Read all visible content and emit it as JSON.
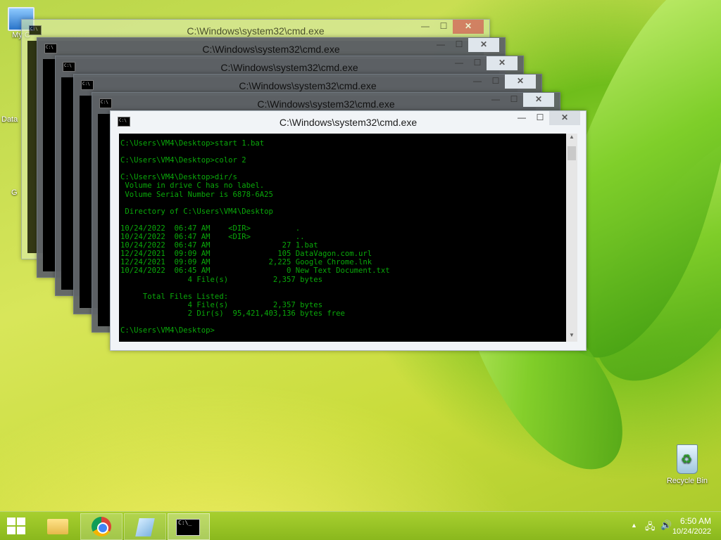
{
  "desktop": {
    "icons": [
      {
        "label": "My C"
      },
      {
        "label": "Data"
      },
      {
        "label": "G"
      },
      {
        "label": "Recycle Bin"
      }
    ]
  },
  "windows": {
    "back1_title": "C:\\Windows\\system32\\cmd.exe",
    "back2_title": "C:\\Windows\\system32\\cmd.exe",
    "back3_title": "C:\\Windows\\system32\\cmd.exe",
    "back4_title": "C:\\Windows\\system32\\cmd.exe",
    "back5_title": "C:\\Windows\\system32\\cmd.exe",
    "main_title": "C:\\Windows\\system32\\cmd.exe",
    "minimize": "—",
    "maximize": "☐",
    "close": "✕",
    "console_lines": [
      "C:\\Users\\VM4\\Desktop>start 1.bat",
      "",
      "C:\\Users\\VM4\\Desktop>color 2",
      "",
      "C:\\Users\\VM4\\Desktop>dir/s",
      " Volume in drive C has no label.",
      " Volume Serial Number is 6878-6A25",
      "",
      " Directory of C:\\Users\\VM4\\Desktop",
      "",
      "10/24/2022  06:47 AM    <DIR>          .",
      "10/24/2022  06:47 AM    <DIR>          ..",
      "10/24/2022  06:47 AM                27 1.bat",
      "12/24/2021  09:09 AM               105 DataVagon.com.url",
      "12/24/2021  09:09 AM             2,225 Google Chrome.lnk",
      "10/24/2022  06:45 AM                 0 New Text Document.txt",
      "               4 File(s)          2,357 bytes",
      "",
      "     Total Files Listed:",
      "               4 File(s)          2,357 bytes",
      "               2 Dir(s)  95,421,403,136 bytes free",
      "",
      "C:\\Users\\VM4\\Desktop>"
    ]
  },
  "taskbar": {
    "apps": [
      {
        "name": "File Explorer"
      },
      {
        "name": "Google Chrome"
      },
      {
        "name": "Notes"
      },
      {
        "name": "Command Prompt",
        "icon_text": "C:\\_"
      }
    ],
    "tray": {
      "time": "6:50 AM",
      "date": "10/24/2022"
    }
  }
}
